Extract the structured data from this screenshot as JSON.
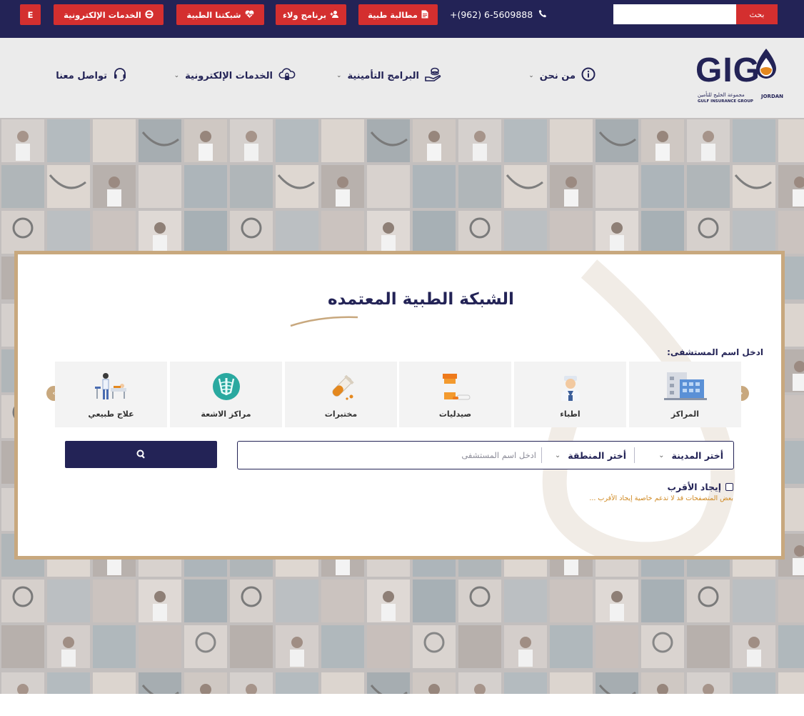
{
  "topbar": {
    "lang_button": "E",
    "eservices_label": "الخدمات الإلكترونية",
    "network_label": "شبكتنا الطبية",
    "loyalty_label": "برنامج ولاء",
    "claim_label": "مطالبة طبية",
    "phone": "+(962) 6-5609888",
    "search_placeholder": "",
    "search_button": "بحث"
  },
  "logo": {
    "text": "GIG",
    "arabic": "مجموعة الخليج للتأمين",
    "english": "GULF INSURANCE GROUP",
    "country": "JORDAN"
  },
  "nav": {
    "about": "من نحن",
    "programs": "البرامج التأمينية",
    "eservices": "الخدمات الإلكترونية",
    "contact": "تواصل معنا"
  },
  "card": {
    "title": "الشبكة الطبية المعتمده",
    "enter_label": "ادخل اسم المستشفى:",
    "categories": [
      {
        "label": "المراكز",
        "icon": "building-icon"
      },
      {
        "label": "اطباء",
        "icon": "doctor-icon"
      },
      {
        "label": "صيدليات",
        "icon": "pill-bottle-icon"
      },
      {
        "label": "مختبرات",
        "icon": "test-tube-icon"
      },
      {
        "label": "مراكز الاشعة",
        "icon": "xray-icon"
      },
      {
        "label": "علاج طبيعي",
        "icon": "physiotherapy-icon"
      }
    ],
    "city_select": "أختر المدينة",
    "area_select": "أختر المنطقة",
    "hospital_placeholder": "ادخل اسم المستشفى",
    "nearest_label": "إيجاد الأقرب",
    "nearest_note": "بعض المتصفحات قد لا تدعم خاصية إيجاد الأقرب ..."
  },
  "colors": {
    "navy": "#232356",
    "red": "#d42f2f",
    "gold": "#c8a87e",
    "orange_note": "#d08a23"
  }
}
